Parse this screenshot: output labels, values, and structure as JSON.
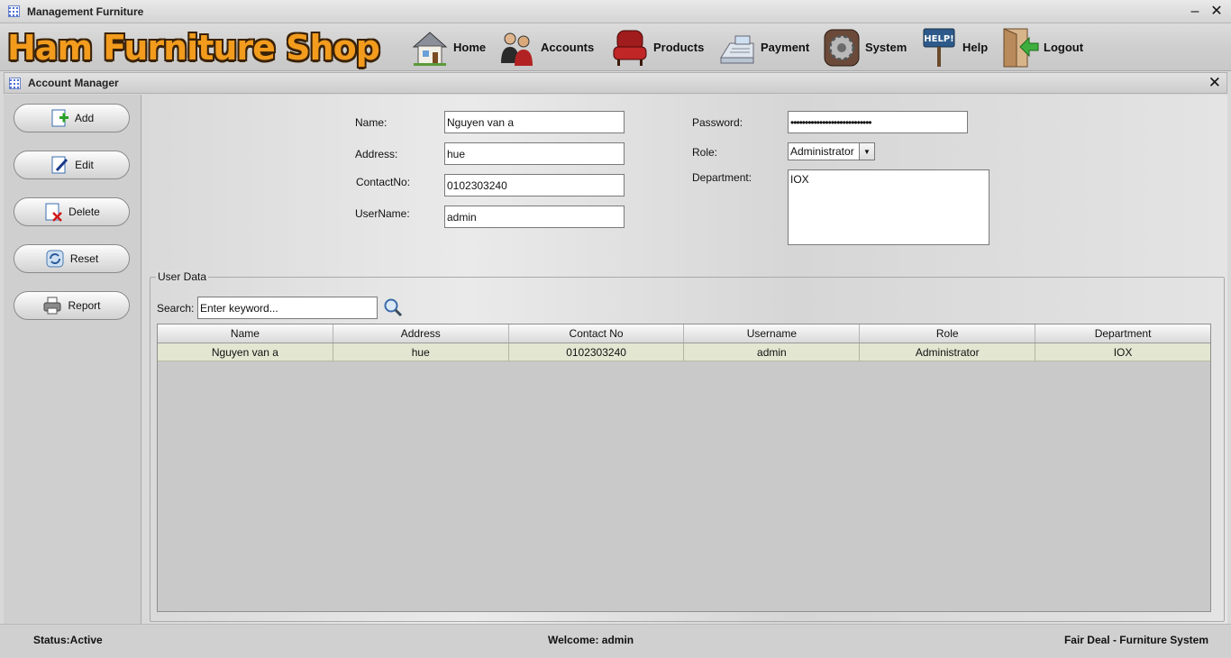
{
  "window": {
    "title": "Management Furniture"
  },
  "brand": {
    "name": "Ham Furniture Shop"
  },
  "nav": [
    {
      "label": "Home",
      "icon": "house-icon"
    },
    {
      "label": "Accounts",
      "icon": "people-icon"
    },
    {
      "label": "Products",
      "icon": "armchair-icon"
    },
    {
      "label": "Payment",
      "icon": "cash-register-icon"
    },
    {
      "label": "System",
      "icon": "gear-icon"
    },
    {
      "label": "Help",
      "icon": "help-sign-icon"
    },
    {
      "label": "Logout",
      "icon": "exit-door-icon"
    }
  ],
  "frame": {
    "title": "Account Manager"
  },
  "actions": [
    {
      "label": "Add",
      "icon": "add-document-icon"
    },
    {
      "label": "Edit",
      "icon": "edit-document-icon"
    },
    {
      "label": "Delete",
      "icon": "delete-document-icon"
    },
    {
      "label": "Reset",
      "icon": "refresh-icon"
    },
    {
      "label": "Report",
      "icon": "printer-icon"
    }
  ],
  "form": {
    "name_label": "Name:",
    "name_value": "Nguyen van a",
    "address_label": "Address:",
    "address_value": "hue",
    "contact_label": "ContactNo:",
    "contact_value": "0102303240",
    "username_label": "UserName:",
    "username_value": "admin",
    "password_label": "Password:",
    "password_value": "••••••••••••••••••••••••••••",
    "role_label": "Role:",
    "role_value": "Administrator",
    "department_label": "Department:",
    "department_value": "IOX"
  },
  "user_data": {
    "group_title": "User Data",
    "search_label": "Search:",
    "search_value": "Enter keyword...",
    "columns": [
      "Name",
      "Address",
      "Contact No",
      "Username",
      "Role",
      "Department"
    ],
    "rows": [
      [
        "Nguyen van a",
        "hue",
        "0102303240",
        "admin",
        "Administrator",
        "IOX"
      ]
    ]
  },
  "status": {
    "state": "Status:Active",
    "welcome": "Welcome: admin",
    "tagline": "Fair Deal - Furniture System"
  },
  "colors": {
    "brand_orange": "#f29b1d",
    "brand_outline": "#3a2208",
    "selected_row": "#e3e6d1",
    "frame_icon_blue": "#4a6fd8"
  }
}
